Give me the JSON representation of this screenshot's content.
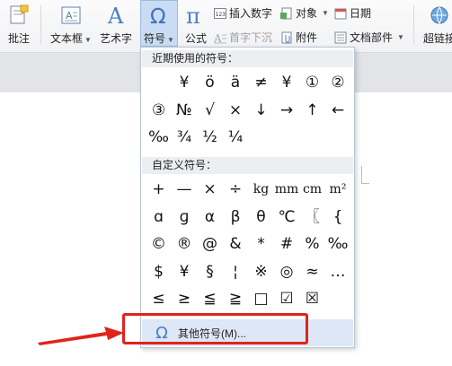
{
  "ribbon": {
    "comment_label": "批注",
    "textbox_label": "文本框",
    "wordart_label": "艺术字",
    "symbol_label": "符号",
    "formula_label": "公式",
    "insert_number_label": "插入数字",
    "dropcap_label": "首字下沉",
    "object_label": "对象",
    "attachment_label": "附件",
    "date_label": "日期",
    "docparts_label": "文档部件",
    "hyperlink_label": "超链接"
  },
  "dropdown": {
    "recent_header": "近期使用的符号：",
    "recent_symbols": [
      "¥",
      "ö",
      "ä",
      "≠",
      "¥",
      "①",
      "②",
      "③",
      "№",
      "√",
      "×",
      "↓",
      "→",
      "↑",
      "←",
      "‰",
      "¾",
      "½",
      "¼"
    ],
    "custom_header": "自定义符号：",
    "custom_symbols": [
      "+",
      "—",
      "×",
      "÷",
      "kg",
      "mm",
      "cm",
      "m²",
      "ɑ",
      "ɡ",
      "α",
      "β",
      "θ",
      "℃",
      "〖",
      "{",
      "©",
      "®",
      "@",
      "&",
      "*",
      "#",
      "%",
      "‰",
      "$",
      "¥",
      "§",
      "¦",
      "※",
      "◎",
      "≈",
      "…",
      "≤",
      "≥",
      "≦",
      "≧",
      "□",
      "☑",
      "☒"
    ],
    "more_symbols_label": "其他符号(M)..."
  },
  "colors": {
    "highlight_box": "#e0231b",
    "arrow": "#e0231b",
    "menu_hover": "#dde7f5",
    "symbol_active_bg": "#c9dcf3",
    "icon_blue": "#4a7fc4"
  }
}
